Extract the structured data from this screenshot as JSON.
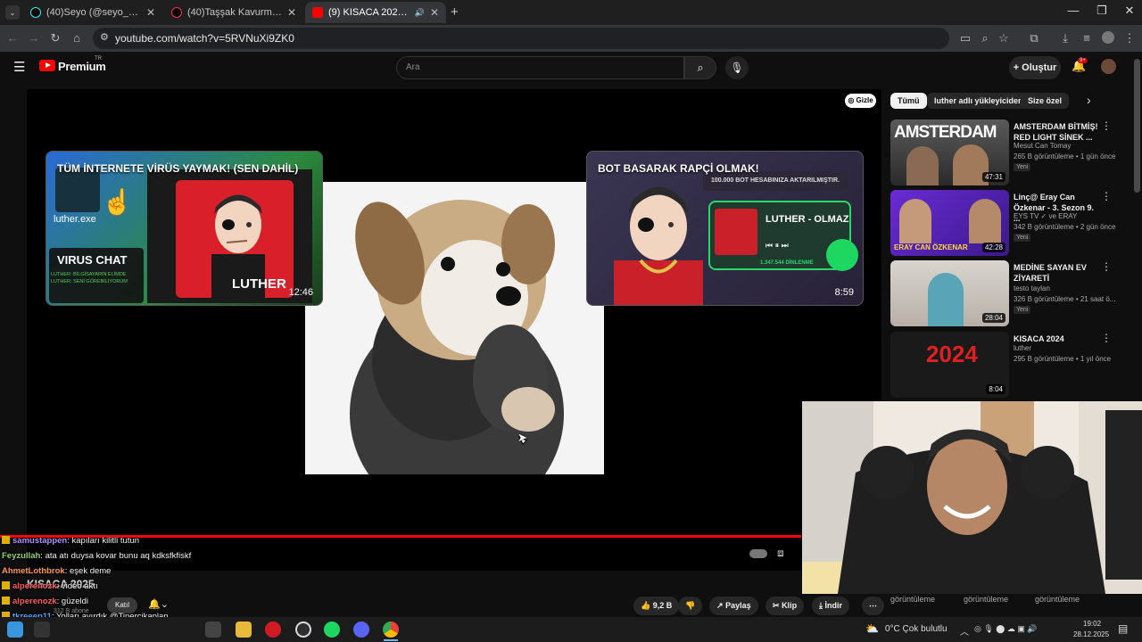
{
  "browser": {
    "tabs": [
      {
        "title": "(40)Seyo (@seyo_malkoc) | TikTok",
        "active": false
      },
      {
        "title": "(40)Taşşak Kavurma Tarifi ve Sunum",
        "active": false
      },
      {
        "title": "(9) KISACA 2025 - YouTube",
        "active": true
      }
    ],
    "new_tab": "+",
    "url": "youtube.com/watch?v=5RVNuXi9ZK0"
  },
  "yt": {
    "logo_text": "Premium",
    "region": "TR",
    "search_placeholder": "Ara",
    "create_label": "+ Oluştur",
    "notif_count": "9+"
  },
  "player": {
    "hide_label": "Gizle",
    "end_cards": [
      {
        "title": "TÜM İNTERNETE VİRÜS YAYMAK! (SEN DAHİL)",
        "duration": "12:46",
        "label": "VIRUS CHAT",
        "sub1": "LUTHER: BİLGİSAYARIN ELİMDE",
        "sub2": "LUTHER: SENİ GÖREBİLİYORUM",
        "exe": "luther.exe",
        "name": "LUTHER"
      },
      {
        "title": "BOT BASARAK RAPÇİ OLMAK!",
        "duration": "8:59",
        "banner": "100.000 BOT HESABINIZA AKTARILMIŞTIR.",
        "song": "LUTHER - OLMAZ",
        "plays": "1.347.544 DİNLENME",
        "name": "LUTHER"
      }
    ]
  },
  "sidebar": {
    "chips": [
      "Tümü",
      "luther adlı yükleyiciden",
      "Size özel"
    ],
    "recs": [
      {
        "title": "AMSTERDAM BİTMİŞ! RED LIGHT SİNEK ...",
        "channel": "Mesut Can Tomay",
        "views": "265 B görüntüleme • 1 gün önce",
        "badge": "Yeni",
        "duration": "47:31",
        "thumb_text": "AMSTERDAM"
      },
      {
        "title": "Linç@ Eray Can Özkenar - 3. Sezon 9. ...",
        "channel": "EYS TV ✓ ve ERAY",
        "views": "342 B görüntüleme • 2 gün önce",
        "badge": "Yeni",
        "duration": "42:28",
        "thumb_text": "ERAY CAN ÖZKENAR"
      },
      {
        "title": "MEDİNE SAYAN EV ZİYARETİ",
        "channel": "testo taylan",
        "views": "326 B görüntüleme • 21 saat ö...",
        "badge": "Yeni",
        "duration": "28:04",
        "thumb_text": ""
      },
      {
        "title": "KISACA 2024",
        "channel": "luther",
        "views": "295 B görüntüleme • 1 yıl önce",
        "badge": "",
        "duration": "8:04",
        "thumb_text": "2024"
      }
    ],
    "partial_views": [
      "görüntüleme",
      "görüntüleme",
      "görüntüleme"
    ]
  },
  "chat": [
    {
      "user": "samustappen",
      "color": "#b28bff",
      "text": ": kapıları kilitli tutun"
    },
    {
      "user": "Feyzullah",
      "color": "#8fd16b",
      "text": ": ata atı duysa kovar bunu aq kdksfkfiskf"
    },
    {
      "user": "AhmetLothbrok",
      "color": "#ff9b3d",
      "text": ": eşek deme"
    },
    {
      "user": "alperenozk",
      "color": "#ff5a5a",
      "text": ": video aktı"
    },
    {
      "user": "alperenozk",
      "color": "#ff5a5a",
      "text": ": güzeldi"
    },
    {
      "user": "tkreeep11",
      "color": "#4da3ff",
      "text": ": Yolları ayırdık @Tinercikaplan"
    },
    {
      "user": "PesContextFener",
      "color": "#4da3ff",
      "text": ": chate gelme ata abinin aq"
    }
  ],
  "video_info": {
    "title": "KISACA 2025",
    "subs": "312 B abone",
    "join_label": "Katıl",
    "like_count": "9,2 B",
    "share": "Paylaş",
    "clip": "Klip",
    "download": "İndir"
  },
  "taskbar": {
    "weather": "0°C  Çok bulutlu",
    "time": "19:02",
    "date": "28.12.2025"
  }
}
